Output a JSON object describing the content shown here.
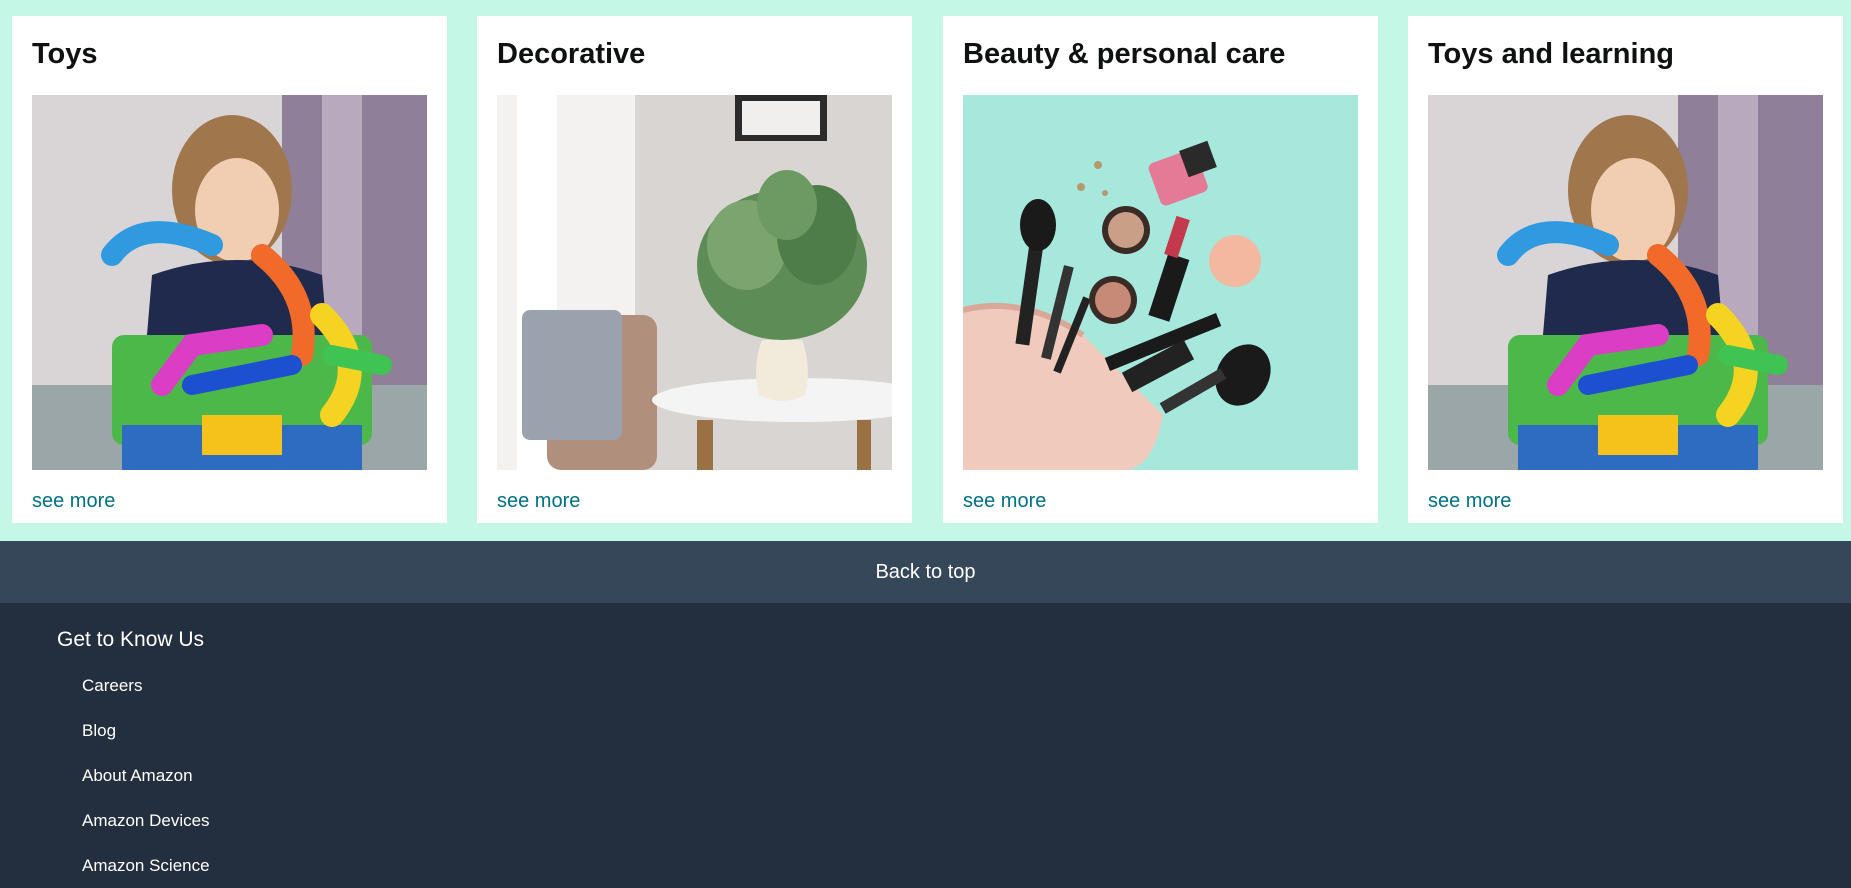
{
  "cards": [
    {
      "title": "Toys",
      "link": "see more",
      "image": "child-with-pop-tubes-toy"
    },
    {
      "title": "Decorative",
      "link": "see more",
      "image": "plant-vase-on-table"
    },
    {
      "title": "Beauty & personal care",
      "link": "see more",
      "image": "makeup-spilling-from-bag"
    },
    {
      "title": "Toys and learning",
      "link": "see more",
      "image": "child-with-pop-tubes-toy"
    }
  ],
  "back_to_top": "Back to top",
  "footer": {
    "heading": "Get to Know Us",
    "links": [
      "Careers",
      "Blog",
      "About Amazon",
      "Amazon Devices",
      "Amazon Science"
    ]
  },
  "colors": {
    "page_bg": "#c4f7e5",
    "link": "#007185",
    "back_to_top_bg": "#37475a",
    "footer_bg": "#232f3e"
  }
}
